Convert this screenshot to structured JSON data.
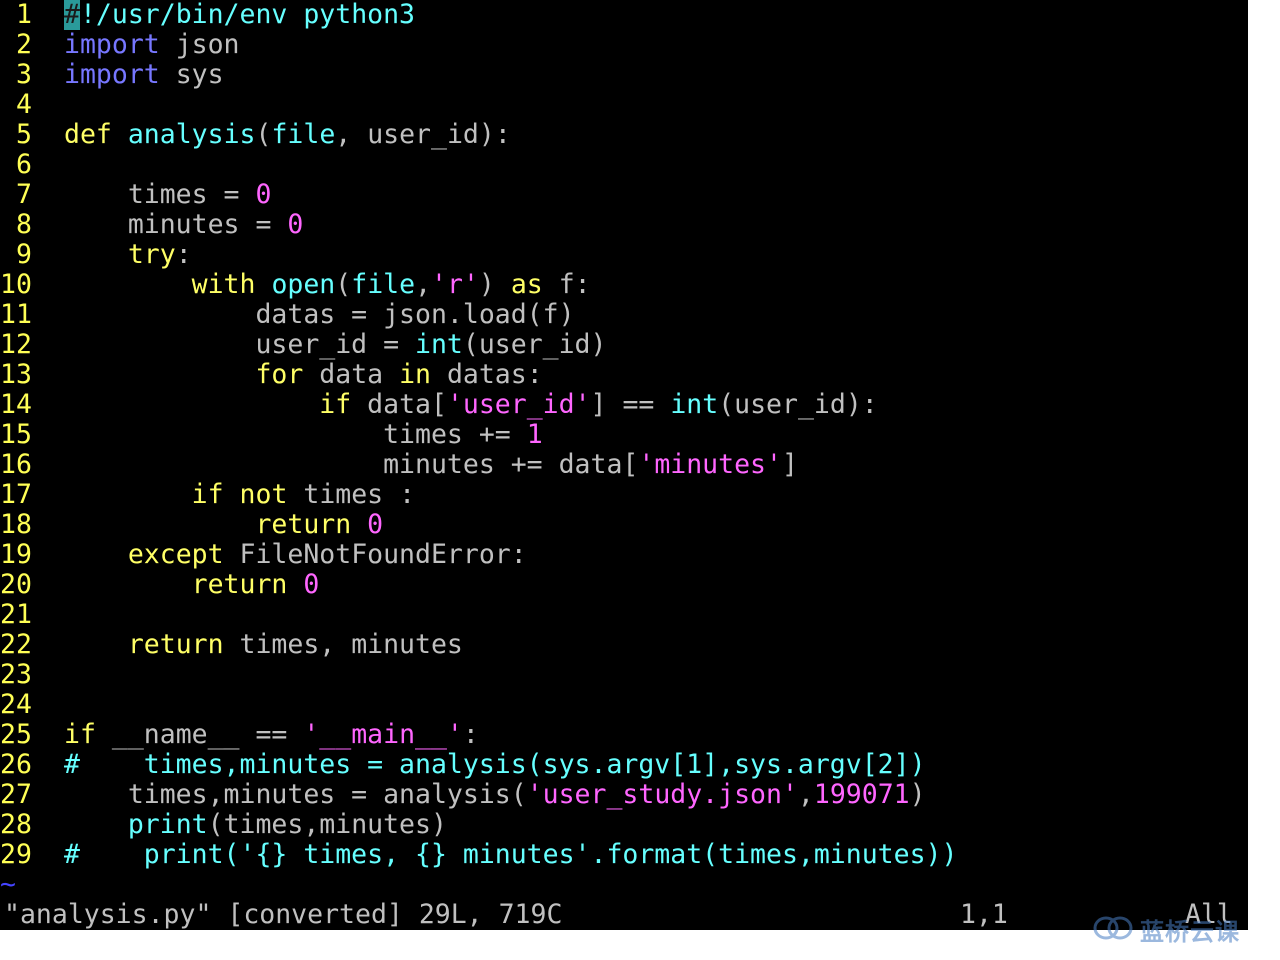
{
  "colors": {
    "background": "#000000",
    "line_number": "#ffff55",
    "keyword": "#ffff66",
    "import": "#7777ff",
    "function_name": "#66ffff",
    "builtin": "#66ffff",
    "string": "#ff66ff",
    "number": "#ff66ff",
    "plain": "#c0c0c0",
    "comment": "#66ffff",
    "tilde": "#4444ff",
    "status": "#c0c0c0",
    "watermark": "#4a7fc4"
  },
  "editor": {
    "lines": [
      {
        "n": " 1",
        "tokens": [
          {
            "t": "#",
            "c": "cursor"
          },
          {
            "t": "!/usr/bin/env python3",
            "c": "comment"
          }
        ]
      },
      {
        "n": " 2",
        "tokens": [
          {
            "t": "import",
            "c": "import"
          },
          {
            "t": " json",
            "c": "plain"
          }
        ]
      },
      {
        "n": " 3",
        "tokens": [
          {
            "t": "import",
            "c": "import"
          },
          {
            "t": " sys",
            "c": "plain"
          }
        ]
      },
      {
        "n": " 4",
        "tokens": []
      },
      {
        "n": " 5",
        "tokens": [
          {
            "t": "def",
            "c": "keyword"
          },
          {
            "t": " ",
            "c": "plain"
          },
          {
            "t": "analysis",
            "c": "function_name"
          },
          {
            "t": "(",
            "c": "plain"
          },
          {
            "t": "file",
            "c": "builtin"
          },
          {
            "t": ", user_id):",
            "c": "plain"
          }
        ]
      },
      {
        "n": " 6",
        "tokens": []
      },
      {
        "n": " 7",
        "tokens": [
          {
            "t": "    times = ",
            "c": "plain"
          },
          {
            "t": "0",
            "c": "number"
          }
        ]
      },
      {
        "n": " 8",
        "tokens": [
          {
            "t": "    minutes = ",
            "c": "plain"
          },
          {
            "t": "0",
            "c": "number"
          }
        ]
      },
      {
        "n": " 9",
        "tokens": [
          {
            "t": "    ",
            "c": "plain"
          },
          {
            "t": "try",
            "c": "keyword"
          },
          {
            "t": ":",
            "c": "plain"
          }
        ]
      },
      {
        "n": "10",
        "tokens": [
          {
            "t": "        ",
            "c": "plain"
          },
          {
            "t": "with",
            "c": "keyword"
          },
          {
            "t": " ",
            "c": "plain"
          },
          {
            "t": "open",
            "c": "builtin"
          },
          {
            "t": "(",
            "c": "plain"
          },
          {
            "t": "file",
            "c": "builtin"
          },
          {
            "t": ",",
            "c": "plain"
          },
          {
            "t": "'r'",
            "c": "string"
          },
          {
            "t": ") ",
            "c": "plain"
          },
          {
            "t": "as",
            "c": "keyword"
          },
          {
            "t": " f:",
            "c": "plain"
          }
        ]
      },
      {
        "n": "11",
        "tokens": [
          {
            "t": "            datas = json.load(f)",
            "c": "plain"
          }
        ]
      },
      {
        "n": "12",
        "tokens": [
          {
            "t": "            user_id = ",
            "c": "plain"
          },
          {
            "t": "int",
            "c": "builtin"
          },
          {
            "t": "(user_id)",
            "c": "plain"
          }
        ]
      },
      {
        "n": "13",
        "tokens": [
          {
            "t": "            ",
            "c": "plain"
          },
          {
            "t": "for",
            "c": "keyword"
          },
          {
            "t": " data ",
            "c": "plain"
          },
          {
            "t": "in",
            "c": "keyword"
          },
          {
            "t": " datas:",
            "c": "plain"
          }
        ]
      },
      {
        "n": "14",
        "tokens": [
          {
            "t": "                ",
            "c": "plain"
          },
          {
            "t": "if",
            "c": "keyword"
          },
          {
            "t": " data[",
            "c": "plain"
          },
          {
            "t": "'user_id'",
            "c": "string"
          },
          {
            "t": "] == ",
            "c": "plain"
          },
          {
            "t": "int",
            "c": "builtin"
          },
          {
            "t": "(user_id):",
            "c": "plain"
          }
        ]
      },
      {
        "n": "15",
        "tokens": [
          {
            "t": "                    times += ",
            "c": "plain"
          },
          {
            "t": "1",
            "c": "number"
          }
        ]
      },
      {
        "n": "16",
        "tokens": [
          {
            "t": "                    minutes += data[",
            "c": "plain"
          },
          {
            "t": "'minutes'",
            "c": "string"
          },
          {
            "t": "]",
            "c": "plain"
          }
        ]
      },
      {
        "n": "17",
        "tokens": [
          {
            "t": "        ",
            "c": "plain"
          },
          {
            "t": "if",
            "c": "keyword"
          },
          {
            "t": " ",
            "c": "plain"
          },
          {
            "t": "not",
            "c": "keyword"
          },
          {
            "t": " times :",
            "c": "plain"
          }
        ]
      },
      {
        "n": "18",
        "tokens": [
          {
            "t": "            ",
            "c": "plain"
          },
          {
            "t": "return",
            "c": "keyword"
          },
          {
            "t": " ",
            "c": "plain"
          },
          {
            "t": "0",
            "c": "number"
          }
        ]
      },
      {
        "n": "19",
        "tokens": [
          {
            "t": "    ",
            "c": "plain"
          },
          {
            "t": "except",
            "c": "keyword"
          },
          {
            "t": " FileNotFoundError:",
            "c": "plain"
          }
        ]
      },
      {
        "n": "20",
        "tokens": [
          {
            "t": "        ",
            "c": "plain"
          },
          {
            "t": "return",
            "c": "keyword"
          },
          {
            "t": " ",
            "c": "plain"
          },
          {
            "t": "0",
            "c": "number"
          }
        ]
      },
      {
        "n": "21",
        "tokens": []
      },
      {
        "n": "22",
        "tokens": [
          {
            "t": "    ",
            "c": "plain"
          },
          {
            "t": "return",
            "c": "keyword"
          },
          {
            "t": " times, minutes",
            "c": "plain"
          }
        ]
      },
      {
        "n": "23",
        "tokens": []
      },
      {
        "n": "24",
        "tokens": []
      },
      {
        "n": "25",
        "tokens": [
          {
            "t": "if",
            "c": "keyword"
          },
          {
            "t": " __name__ == ",
            "c": "plain"
          },
          {
            "t": "'__main__'",
            "c": "string"
          },
          {
            "t": ":",
            "c": "plain"
          }
        ]
      },
      {
        "n": "26",
        "tokens": [
          {
            "t": "#    times,minutes = analysis(sys.argv[1],sys.argv[2])",
            "c": "comment"
          }
        ]
      },
      {
        "n": "27",
        "tokens": [
          {
            "t": "    times,minutes = analysis(",
            "c": "plain"
          },
          {
            "t": "'user_study.json'",
            "c": "string"
          },
          {
            "t": ",",
            "c": "plain"
          },
          {
            "t": "199071",
            "c": "number"
          },
          {
            "t": ")",
            "c": "plain"
          }
        ]
      },
      {
        "n": "28",
        "tokens": [
          {
            "t": "    ",
            "c": "plain"
          },
          {
            "t": "print",
            "c": "builtin"
          },
          {
            "t": "(times,minutes)",
            "c": "plain"
          }
        ]
      },
      {
        "n": "29",
        "tokens": [
          {
            "t": "#    print('{} times, {} minutes'.format(times,minutes))",
            "c": "comment"
          }
        ]
      }
    ],
    "tilde_marker": "~"
  },
  "status": {
    "file_info": "\"analysis.py\" [converted] 29L, 719C",
    "cursor_position": "1,1",
    "scroll_indicator": "All"
  },
  "watermark": {
    "icon": "cloud-logo-icon",
    "text": "蓝桥云课"
  }
}
